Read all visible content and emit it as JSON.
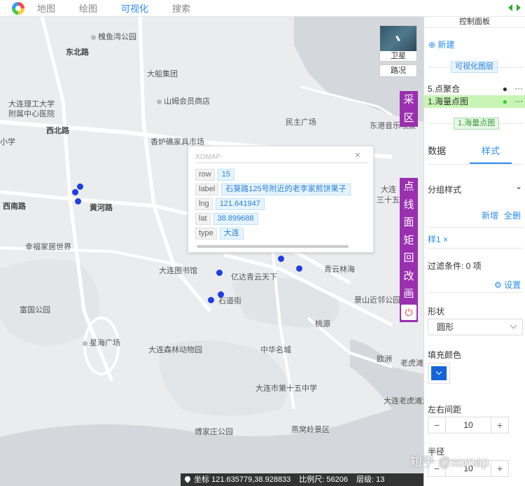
{
  "topbar": {
    "nav": [
      "地图",
      "绘图",
      "可视化",
      "搜索"
    ],
    "active_index": 2
  },
  "map": {
    "labels": {
      "l1": "大连理工大学",
      "l2": "附属中心医院",
      "l3": "西北路",
      "l4": "大船集团",
      "l5": "山姆会员商店",
      "l6": "槐鱼湾公园",
      "l7": "香炉礁家具市场",
      "l8": "民主广场",
      "l9": "东港音乐喷泉",
      "l10": "黄河路",
      "l11": "幸福家居世界",
      "l12": "大连图书馆",
      "l13": "亿达青云天下",
      "l14": "青云林海",
      "l15": "景山近邻公园",
      "l16": "富国公园",
      "l17": "星海广场",
      "l18": "大连森林动物园",
      "l19": "中华名城",
      "l20": "大连市第十五中学",
      "l21": "傅家庄公园",
      "l22": "燕窝岭景区",
      "l23": "大连老虎滩海洋公园",
      "l24": "桃源",
      "l25": "大连",
      "l26": "三十五",
      "l27": "石道街",
      "l28": "小学",
      "l29": "西南路",
      "l30": "老虎滩",
      "l31": "欧洲",
      "l32": "东北路"
    },
    "satellite_label": "卫星",
    "road_label": "路况"
  },
  "tools_top": [
    "采",
    "区"
  ],
  "tools_bottom": [
    "点",
    "线",
    "面",
    "矩",
    "回",
    "改",
    "画"
  ],
  "power_icon": "power-icon",
  "popup": {
    "title": "XOMAP",
    "close": "×",
    "rows": [
      {
        "key": "row",
        "value": "15"
      },
      {
        "key": "label",
        "value": "石葵路125号附近的老李家煎饼果子"
      },
      {
        "key": "lng",
        "value": "121.641947"
      },
      {
        "key": "lat",
        "value": "38.899688"
      },
      {
        "key": "type",
        "value": "大连"
      }
    ]
  },
  "status": {
    "coord_label": "坐标",
    "coord": "121.635779,38.928833",
    "scale_label": "比例尺:",
    "scale": "56206",
    "zoom_label": "层级:",
    "zoom": "13"
  },
  "panel": {
    "title": "控制面板",
    "new_label": "新建",
    "layers_chip": "可视化图层",
    "layers": [
      {
        "name": "5.点聚合",
        "selected": false
      },
      {
        "name": "1.海量点图",
        "selected": true
      }
    ],
    "layer_chip2": "1.海量点图",
    "tabs": [
      "数据",
      "样式"
    ],
    "active_tab": 1,
    "group_style": "分组样式",
    "add": "新增",
    "delete_all": "全删",
    "style_tag": "样1",
    "filter": "过滤条件: 0 项",
    "settings": "设置",
    "shape_label": "形状",
    "shape_value": "圆形",
    "fill_label": "填充颜色",
    "fill_color": "#1565d8",
    "spacing_label": "左右间距",
    "spacing_value": "10",
    "radius_label": "半径",
    "radius_value": "10"
  },
  "watermark": "知乎 @xomap"
}
